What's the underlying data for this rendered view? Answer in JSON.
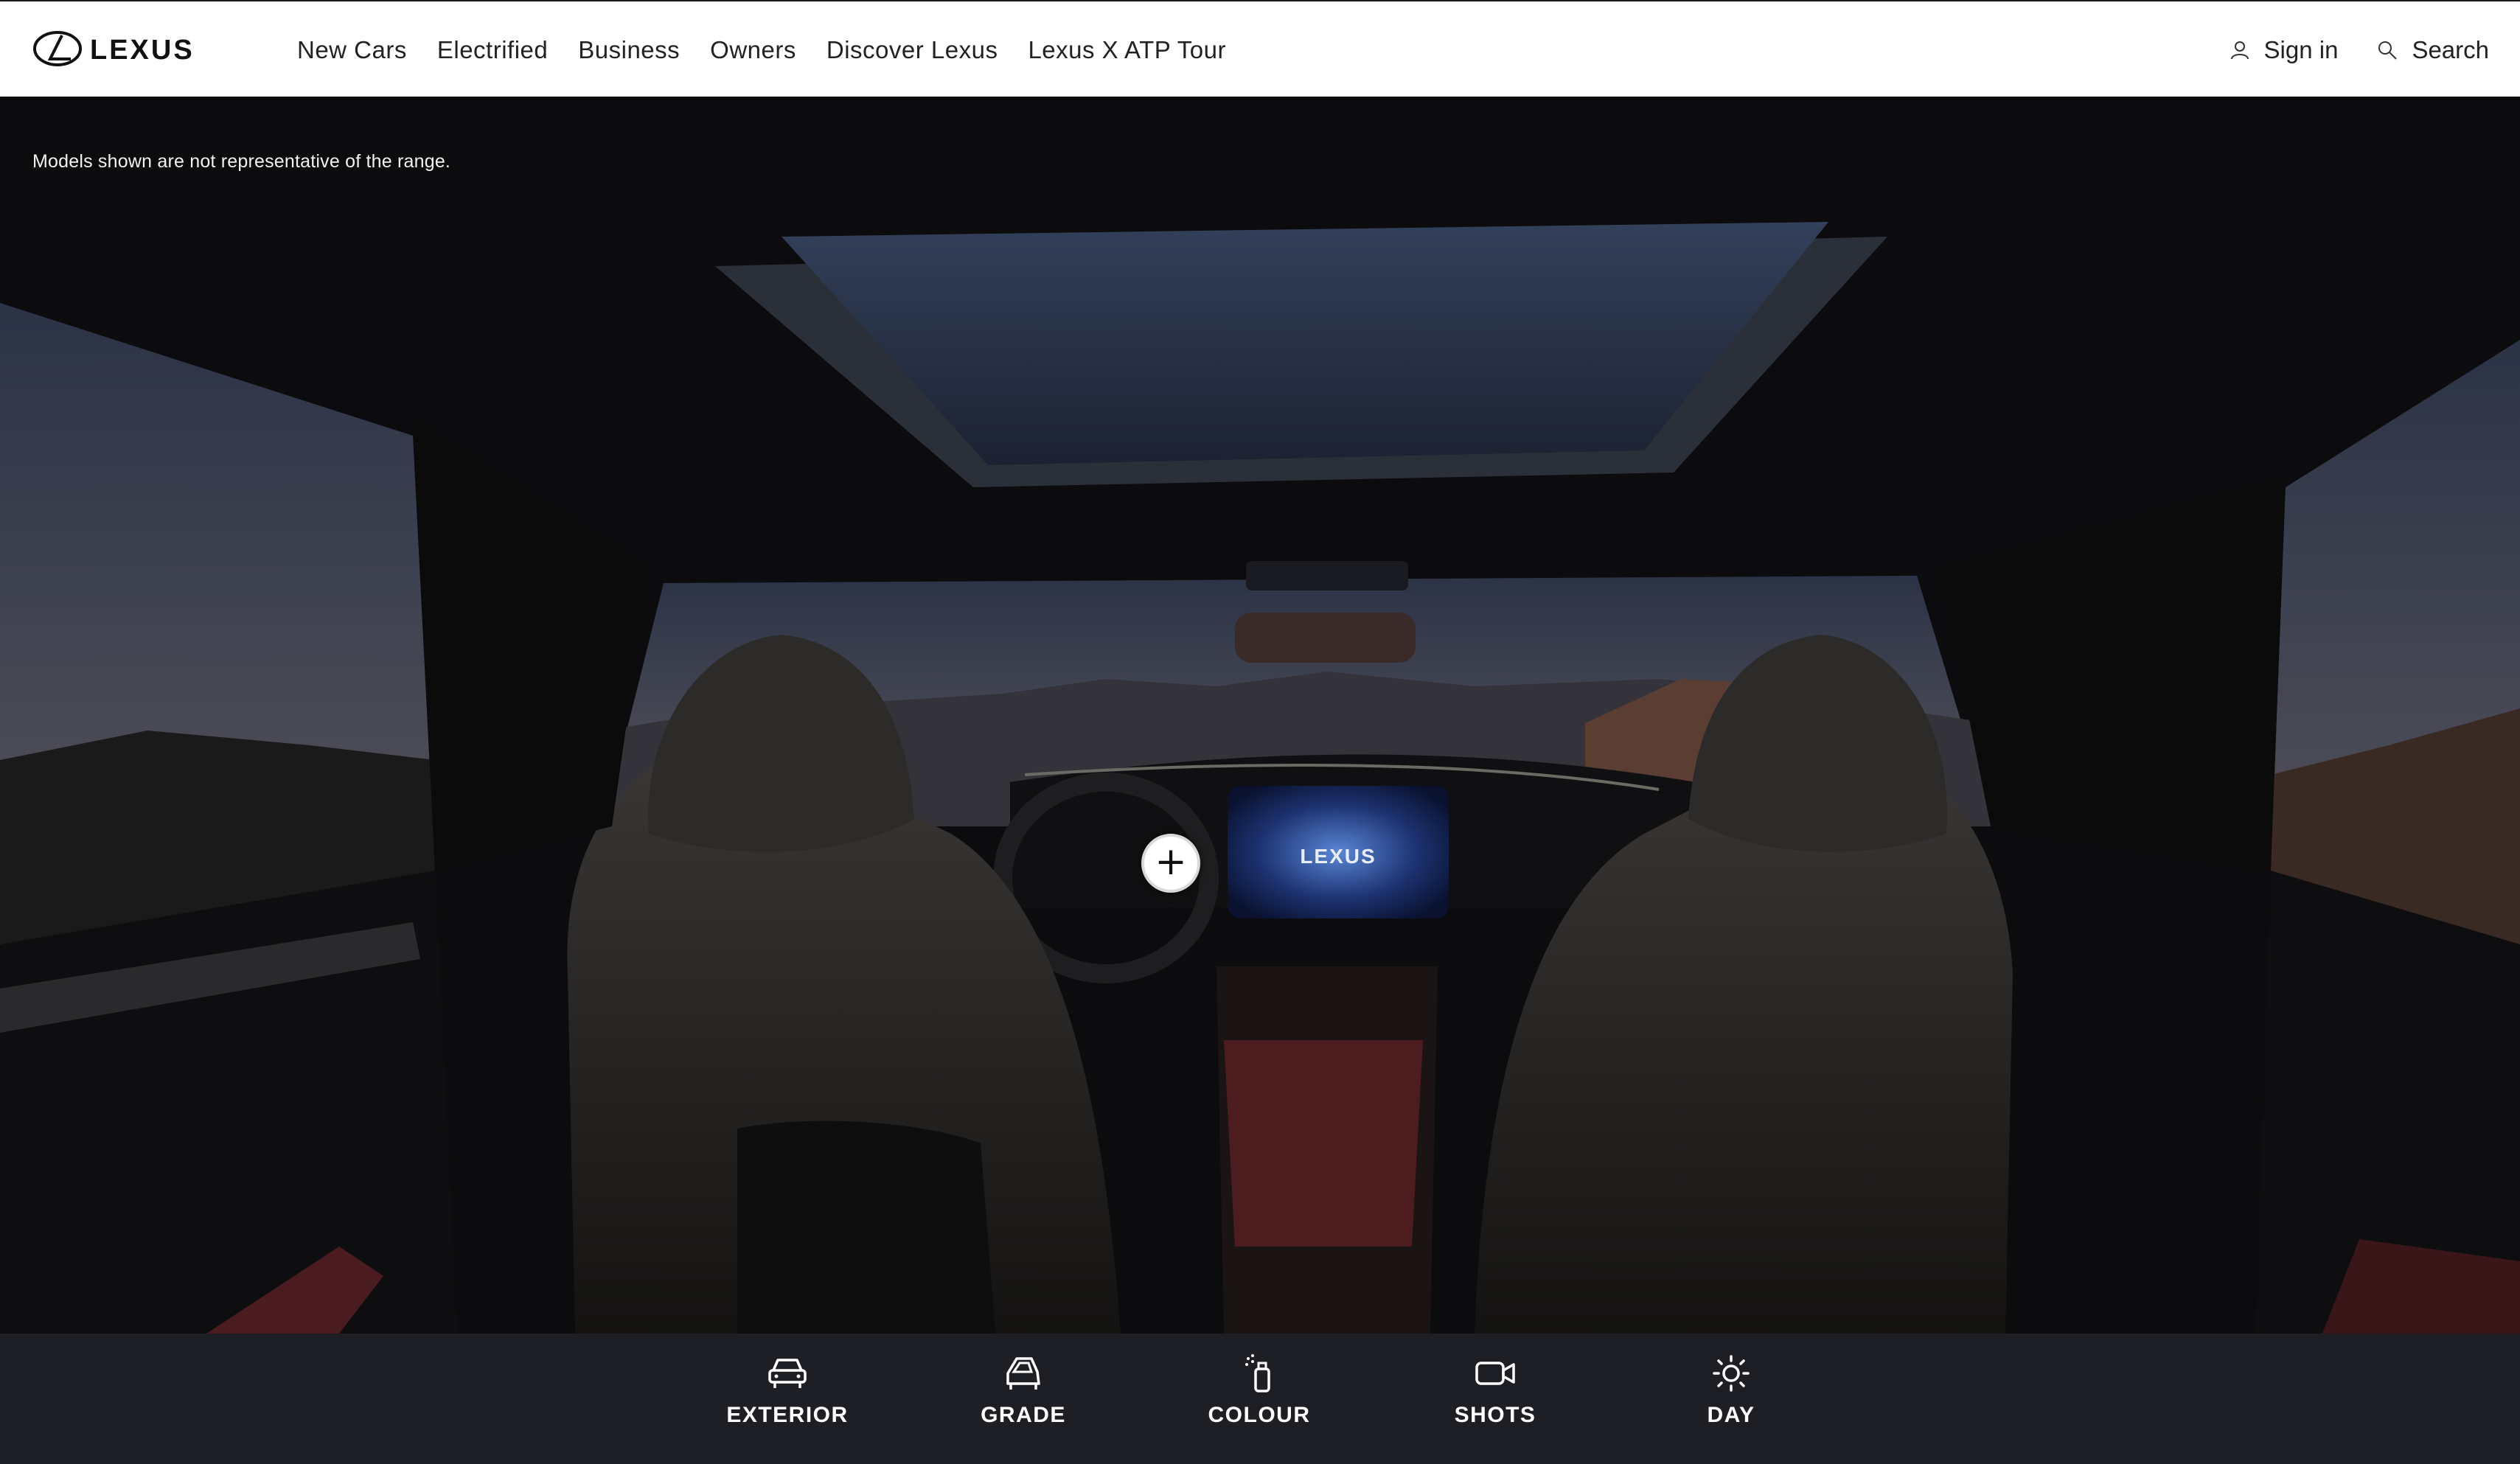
{
  "header": {
    "logo_alt": "LEXUS",
    "nav": [
      {
        "label": "New Cars"
      },
      {
        "label": "Electrified"
      },
      {
        "label": "Business"
      },
      {
        "label": "Owners"
      },
      {
        "label": "Discover Lexus"
      },
      {
        "label": "Lexus X ATP Tour"
      }
    ],
    "sign_in": "Sign in",
    "search": "Search",
    "icons": {
      "sign_in": "user-icon",
      "search": "search-icon"
    }
  },
  "hero": {
    "disclaimer": "Models shown are not representative of the range.",
    "hotspot_symbol": "+",
    "screen_logo": "LEXUS"
  },
  "controls": [
    {
      "label": "EXTERIOR",
      "icon": "car-front-icon"
    },
    {
      "label": "GRADE",
      "icon": "car-side-icon"
    },
    {
      "label": "COLOUR",
      "icon": "spray-paint-icon"
    },
    {
      "label": "SHOTS",
      "icon": "video-camera-icon"
    },
    {
      "label": "DAY",
      "icon": "sun-icon"
    }
  ],
  "colors": {
    "header_bg": "#ffffff",
    "bottom_bar_bg": "#1e1f25",
    "text_dark": "#222222",
    "accent_red": "#5a1a1e"
  }
}
